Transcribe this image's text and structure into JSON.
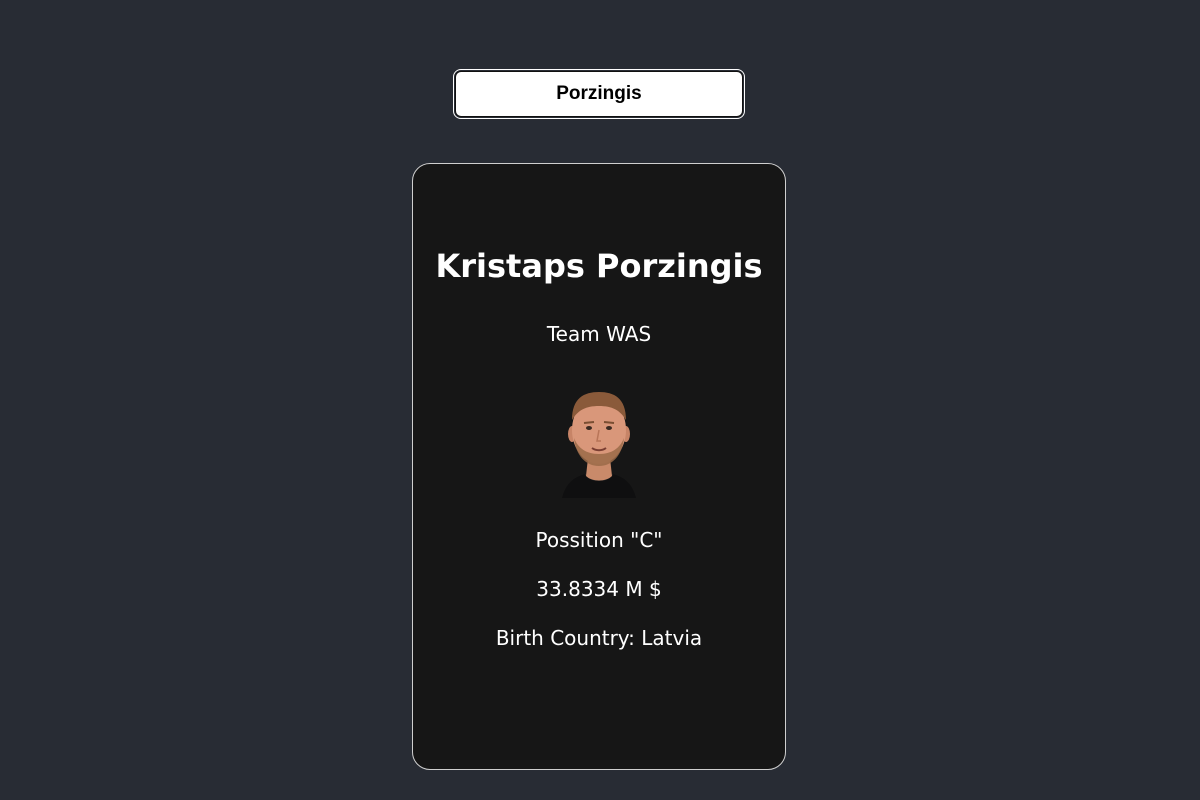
{
  "search": {
    "value": "Porzingis"
  },
  "card": {
    "name": "Kristaps Porzingis",
    "team": "Team WAS",
    "position": "Possition \"C\"",
    "salary": "33.8334 M $",
    "birth_country": "Birth Country: Latvia",
    "photo_icon": "player-headshot"
  },
  "colors": {
    "page_background": "#282c34",
    "card_background": "#161616",
    "text": "#ffffff"
  }
}
